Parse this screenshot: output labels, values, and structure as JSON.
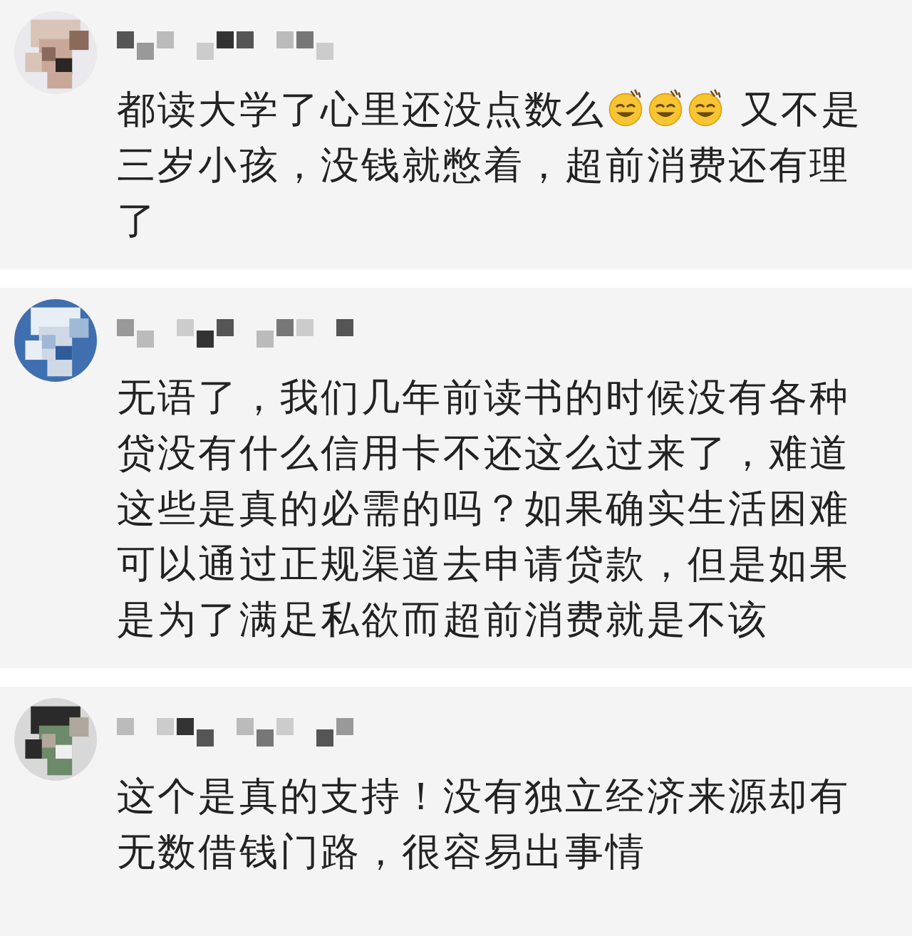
{
  "comments": [
    {
      "body": [
        {
          "kind": "text",
          "text": "都读大学了心里还没点数么"
        },
        {
          "kind": "emoji"
        },
        {
          "kind": "emoji"
        },
        {
          "kind": "emoji"
        },
        {
          "kind": "text",
          "text": " 又不是三岁小孩，没钱就憋着，超前消费还有理了"
        }
      ]
    },
    {
      "body": [
        {
          "kind": "text",
          "text": "无语了，我们几年前读书的时候没有各种贷没有什么信用卡不还这么过来了，难道这些是真的必需的吗？如果确实生活困难可以通过正规渠道去申请贷款，但是如果是为了满足私欲而超前消费就是不该"
        }
      ]
    },
    {
      "body": [
        {
          "kind": "text",
          "text": "这个是真的支持！没有独立经济来源却有无数借钱门路，很容易出事情"
        }
      ]
    }
  ]
}
